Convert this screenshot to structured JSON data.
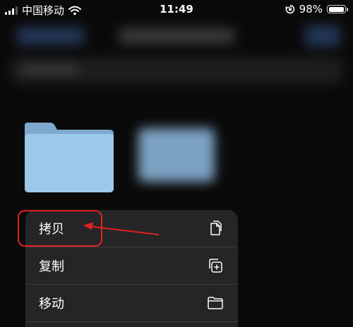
{
  "status_bar": {
    "carrier": "中国移动",
    "time": "11:49",
    "battery_percent_label": "98%",
    "battery_level": 0.98,
    "icons": [
      "signal-icon",
      "wifi-icon",
      "orientation-lock-icon",
      "battery-icon"
    ]
  },
  "context_menu": {
    "items": [
      {
        "label": "拷贝",
        "icon": "copy-icon"
      },
      {
        "label": "复制",
        "icon": "duplicate-icon"
      },
      {
        "label": "移动",
        "icon": "folder-icon"
      }
    ]
  },
  "colors": {
    "accent_annotation": "#e02020",
    "folder_blue": "#9cc8ea",
    "menu_background": "#252527"
  }
}
